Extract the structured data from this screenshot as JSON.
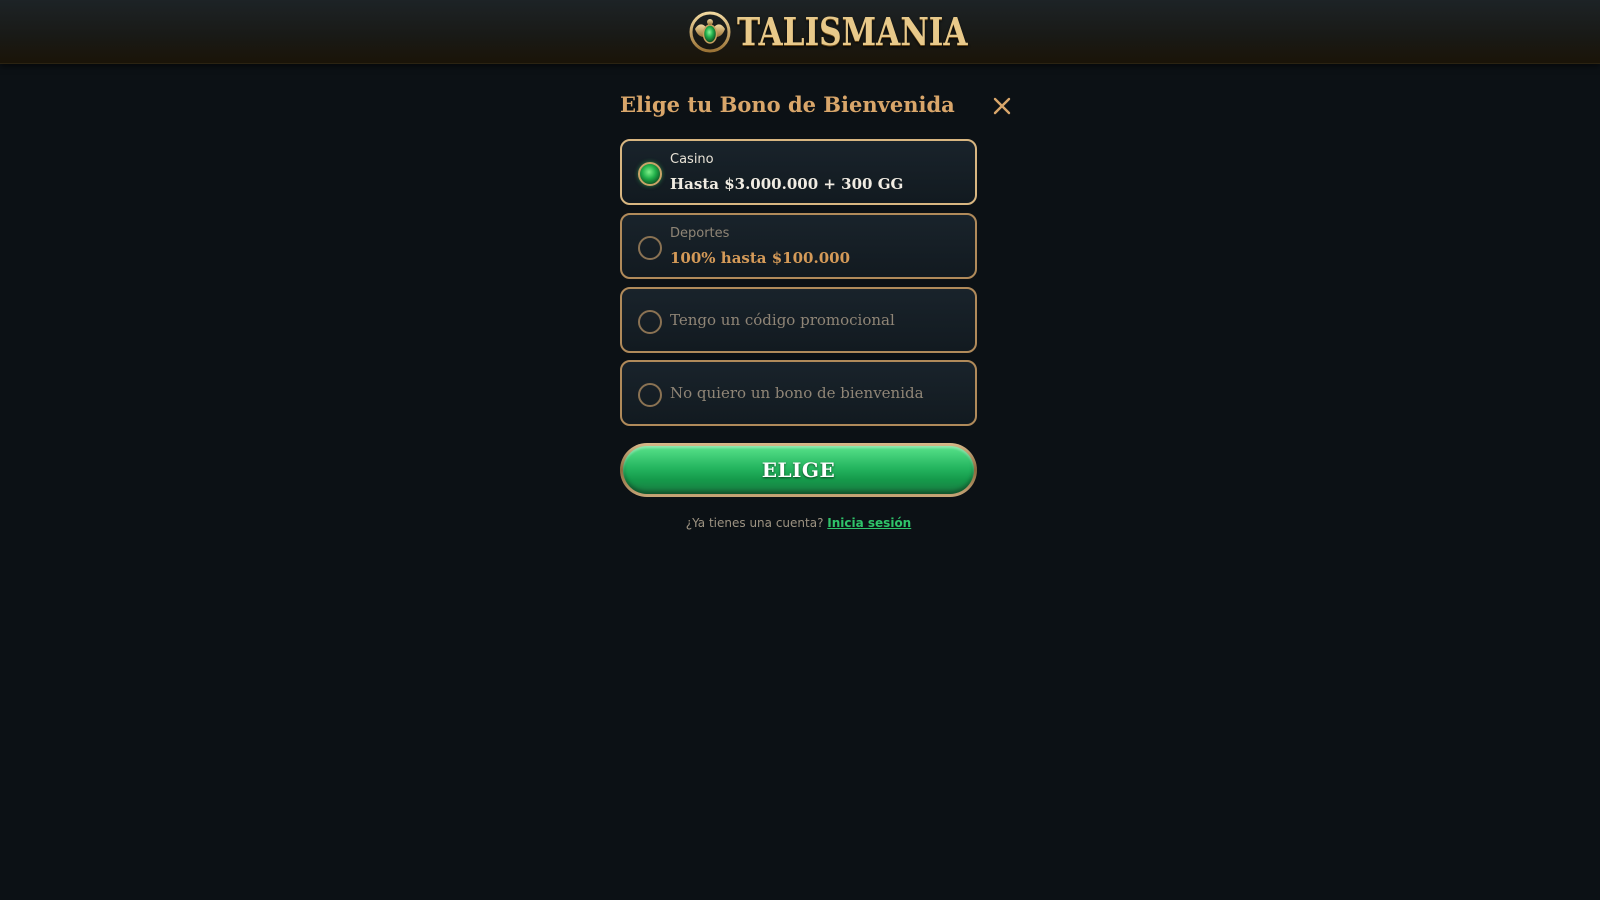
{
  "brand": {
    "logo_text": "TALISMANIA",
    "emblem_icon": "scarab-gem-icon",
    "gold": "#e8c98a",
    "green_gem": "#21b04a"
  },
  "modal": {
    "title": "Elige tu Bono de Bienvenida",
    "close_icon": "close-icon",
    "options": [
      {
        "category": "Casino",
        "label": "Hasta $3.000.000 + 300 GG",
        "selected": true
      },
      {
        "category": "Deportes",
        "label": "100% hasta $100.000",
        "selected": false
      },
      {
        "label": "Tengo un código promocional",
        "selected": false
      },
      {
        "label": "No quiero un bono de bienvenida",
        "selected": false
      }
    ],
    "submit_label": "ELIGE",
    "login_prompt": "¿Ya tienes una cuenta?",
    "login_link": "Inicia sesión"
  },
  "colors": {
    "background": "#0c1115",
    "title": "#d9a66a",
    "option_border": "#b08a5a",
    "button_green": "#25b660",
    "link_green": "#2fc46a"
  }
}
